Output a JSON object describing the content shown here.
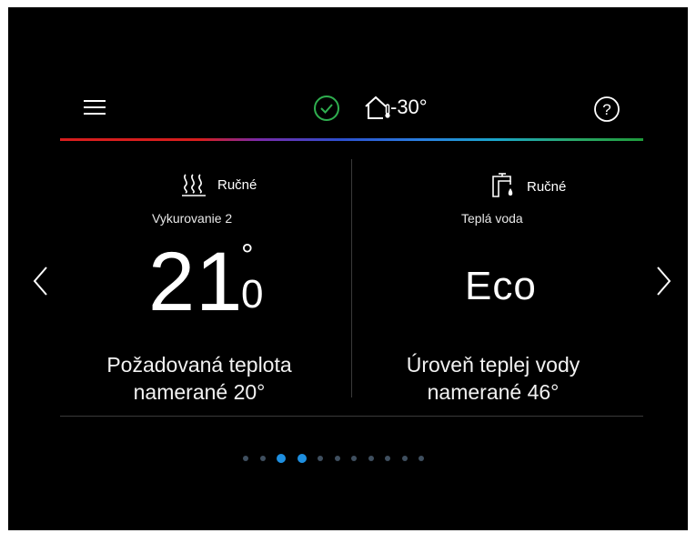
{
  "header": {
    "menu_icon": "hamburger-menu-icon",
    "status_icon": "check-circle-icon",
    "status_color": "#2fae4f",
    "outdoor_icon": "house-thermometer-icon",
    "outdoor_temp": "-30°",
    "help_icon": "question-circle-icon"
  },
  "panels": [
    {
      "icon": "heating-waves-icon",
      "mode": "Ručné",
      "zone": "Vykurovanie 2",
      "value": "21",
      "degree": "°",
      "decimal": "0",
      "desc_line1": "Požadovaná teplota",
      "desc_line2": "namerané 20°"
    },
    {
      "icon": "faucet-drop-icon",
      "mode": "Ručné",
      "zone": "Teplá voda",
      "value": "Eco",
      "desc_line1": "Úroveň teplej vody",
      "desc_line2": "namerané 46°"
    }
  ],
  "navigation": {
    "prev_icon": "chevron-left-icon",
    "next_icon": "chevron-right-icon"
  },
  "pagination": {
    "total": 11,
    "active": [
      2,
      3
    ],
    "active_color": "#1e8fe0"
  }
}
